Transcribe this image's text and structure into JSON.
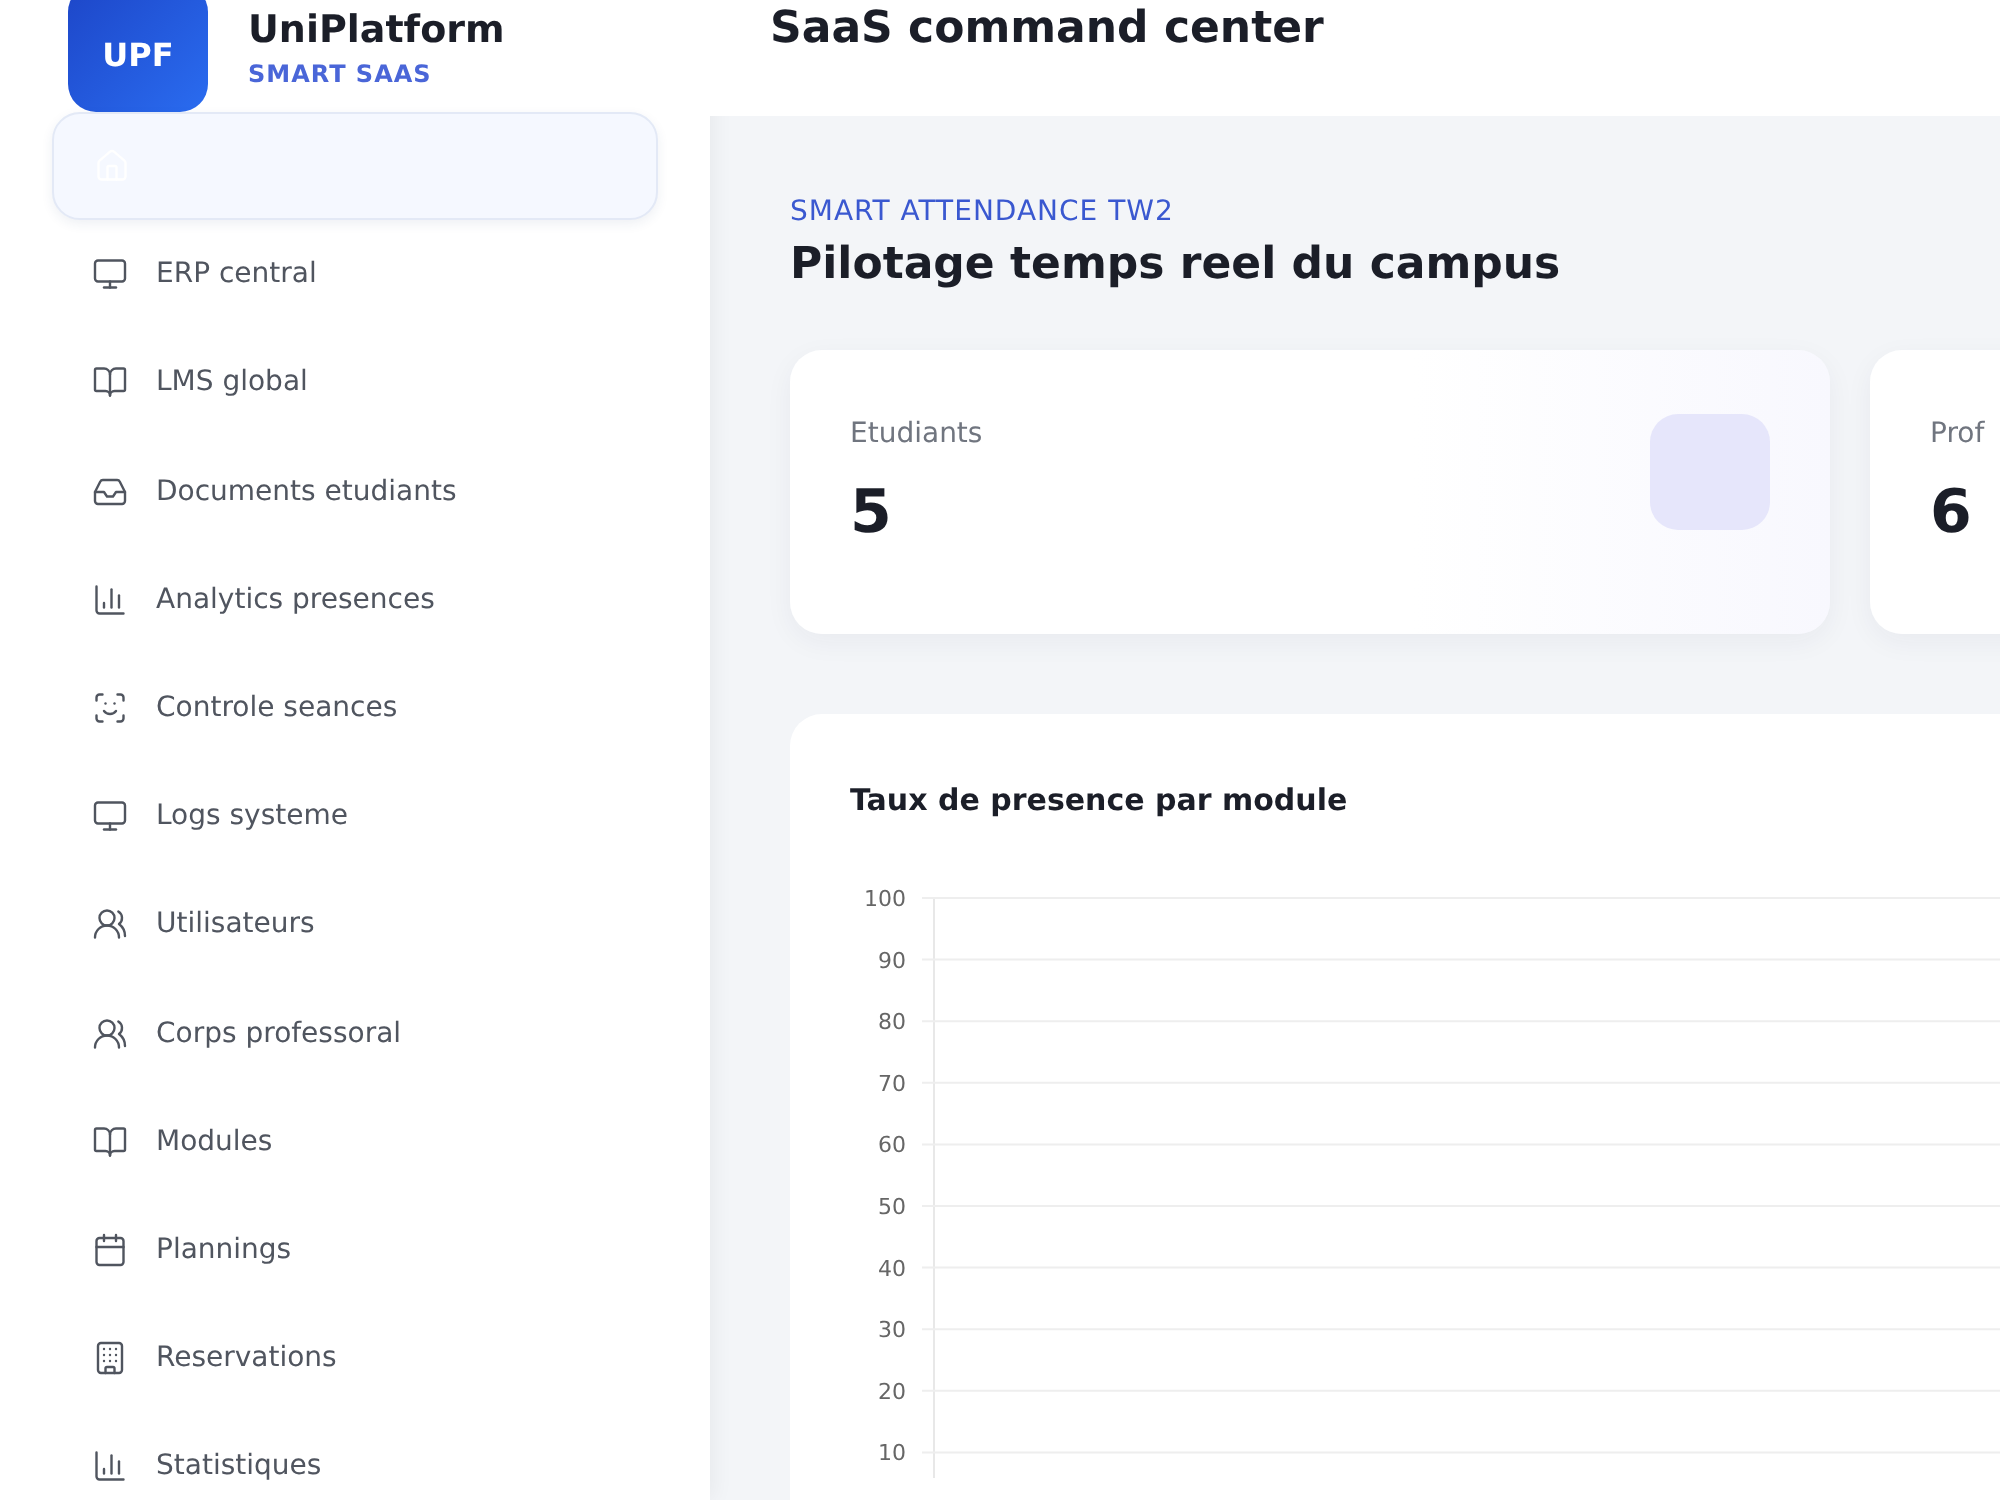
{
  "brand": {
    "logo": "UPF",
    "name": "UniPlatform",
    "tagline": "SMART SAAS"
  },
  "nav": [
    {
      "selected": true
    },
    {
      "label": "ERP central",
      "selected": false
    },
    {
      "label": "LMS global",
      "selected": false
    },
    {
      "label": "Documents etudiants",
      "selected": false
    },
    {
      "label": "Analytics presences",
      "selected": false
    },
    {
      "label": "Controle seances",
      "selected": false
    },
    {
      "label": "Logs systeme",
      "selected": false
    },
    {
      "label": "Utilisateurs",
      "selected": false
    },
    {
      "label": "Corps professoral",
      "selected": false
    },
    {
      "label": "Modules",
      "selected": false
    },
    {
      "label": "Plannings",
      "selected": false
    },
    {
      "label": "Reservations",
      "selected": false
    },
    {
      "label": "Statistiques",
      "selected": false
    }
  ],
  "header": {
    "title": "SaaS command center"
  },
  "section": {
    "eyebrow": "SMART ATTENDANCE TW2",
    "title": "Pilotage temps reel du campus"
  },
  "stats": [
    {
      "label": "Etudiants",
      "value": "5",
      "icon_tile": true
    },
    {
      "label": "Prof",
      "value": "6"
    }
  ],
  "chart": {
    "title": "Taux de presence par module",
    "y_labels": [
      "100",
      "90",
      "80",
      "70",
      "60",
      "50",
      "40",
      "30",
      "20",
      "10"
    ]
  }
}
